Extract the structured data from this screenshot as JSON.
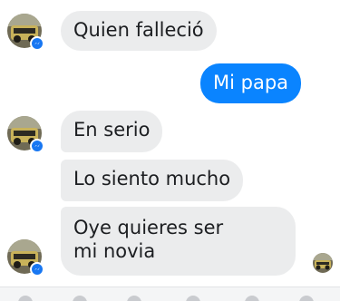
{
  "conversation": {
    "messages": [
      {
        "direction": "incoming",
        "text": "Quien falleció"
      },
      {
        "direction": "outgoing",
        "text": "Mi papa"
      },
      {
        "direction": "incoming",
        "text": "En serio"
      },
      {
        "direction": "incoming",
        "text": "Lo siento mucho"
      },
      {
        "direction": "incoming",
        "text_line1": "Oye quieres ser",
        "text_line2": "mi novia"
      }
    ],
    "contact": {
      "avatar_icon": "contact-avatar",
      "badge_icon": "messenger-badge-icon"
    },
    "seen_indicator_icon": "seen-avatar-icon",
    "colors": {
      "outgoing_bubble": "#0a84ff",
      "incoming_bubble": "#ebeced",
      "badge": "#1877f2"
    }
  }
}
